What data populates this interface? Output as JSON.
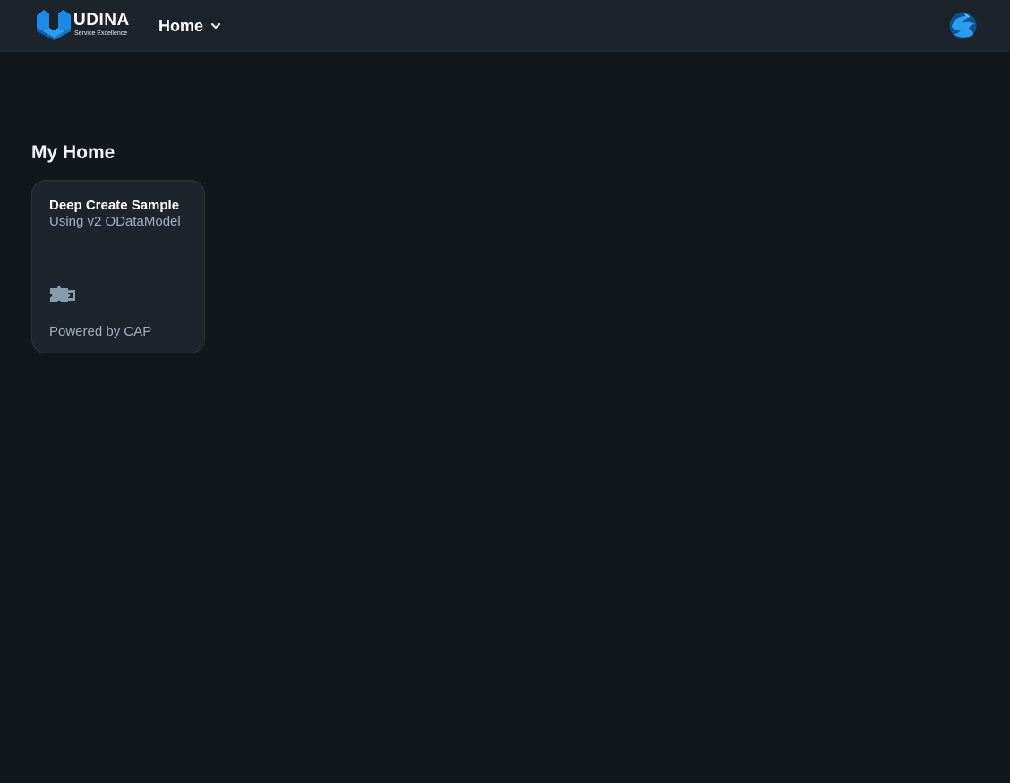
{
  "shellbar": {
    "logo_text": "UDINA",
    "logo_subtext": "Service Excellence",
    "nav_label": "Home",
    "brand_color": "#1a8ae6"
  },
  "page": {
    "title": "My Home"
  },
  "tile": {
    "title": "Deep Create Sample",
    "subtitle": "Using v2 ODataModel",
    "icon": "puzzle-icon",
    "footer": "Powered by CAP"
  }
}
